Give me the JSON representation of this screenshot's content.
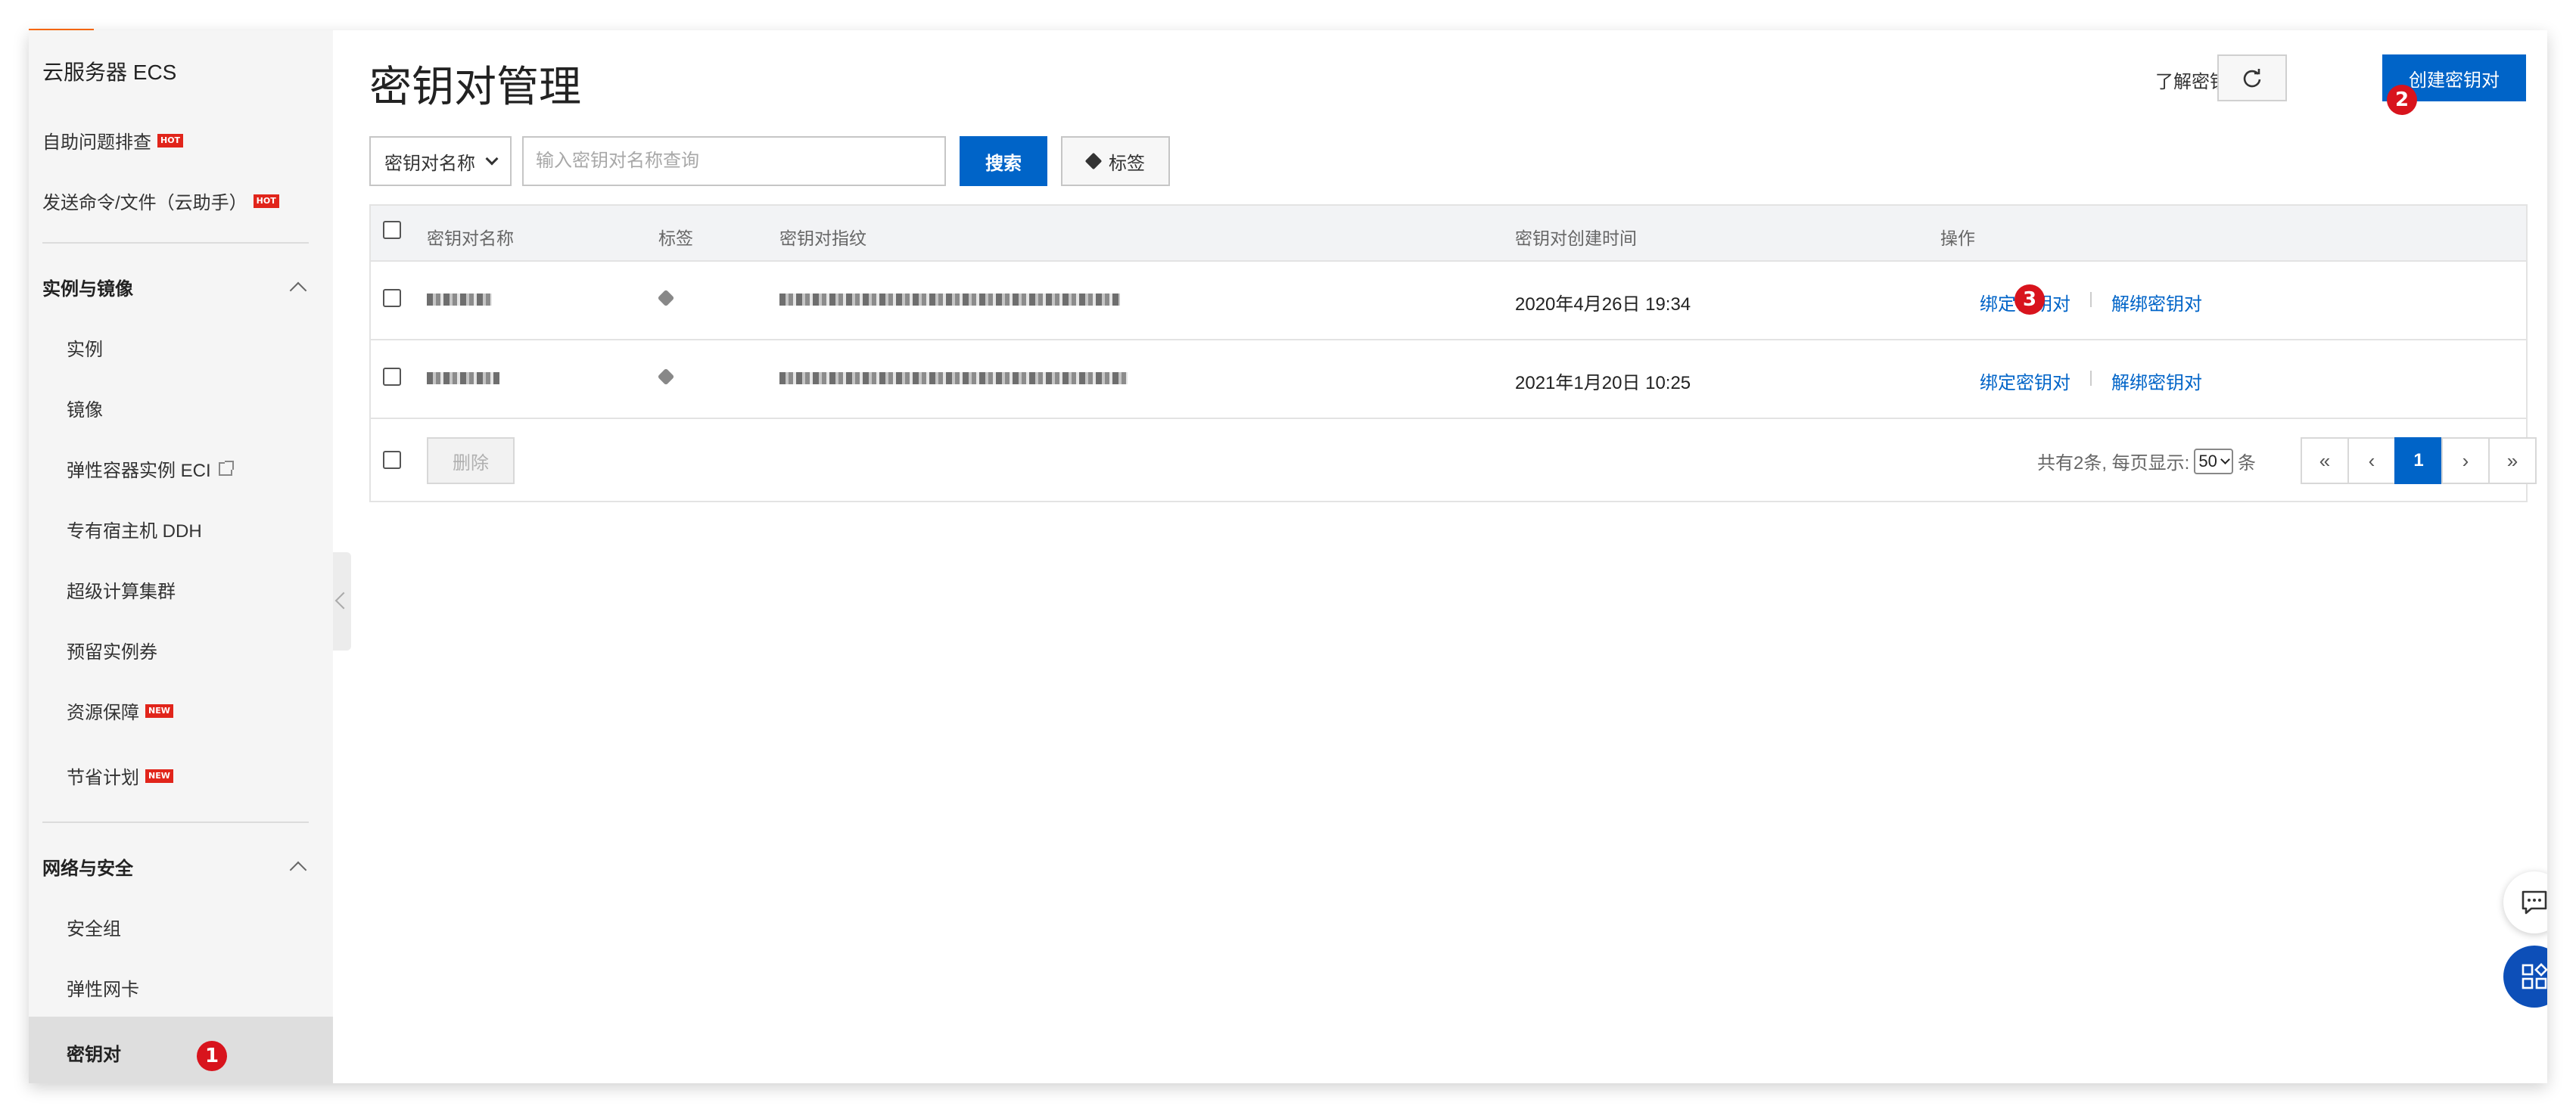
{
  "sidebar": {
    "title": "云服务器 ECS",
    "top_items": [
      {
        "label": "自助问题排查",
        "badge": "HOT"
      },
      {
        "label": "发送命令/文件（云助手）",
        "badge": "HOT"
      }
    ],
    "groups": [
      {
        "label": "实例与镜像",
        "items": [
          {
            "label": "实例"
          },
          {
            "label": "镜像"
          },
          {
            "label": "弹性容器实例 ECI"
          },
          {
            "label": "专有宿主机 DDH"
          },
          {
            "label": "超级计算集群"
          },
          {
            "label": "预留实例券"
          },
          {
            "label": "资源保障",
            "badge": "NEW"
          },
          {
            "label": "节省计划",
            "badge": "NEW"
          }
        ]
      },
      {
        "label": "网络与安全",
        "items": [
          {
            "label": "安全组"
          },
          {
            "label": "弹性网卡"
          },
          {
            "label": "密钥对"
          }
        ]
      }
    ]
  },
  "header": {
    "title": "密钥对管理",
    "help_link": "了解密钥对必读",
    "create_button": "创建密钥对"
  },
  "filter": {
    "select_value": "密钥对名称",
    "input_placeholder": "输入密钥对名称查询",
    "search_button": "搜索",
    "tag_button": "标签"
  },
  "table": {
    "columns": [
      "密钥对名称",
      "标签",
      "密钥对指纹",
      "密钥对创建时间",
      "操作"
    ],
    "rows": [
      {
        "created": "2020年4月26日 19:34",
        "bind": "绑定密钥对",
        "unbind": "解绑密钥对"
      },
      {
        "created": "2021年1月20日 10:25",
        "bind": "绑定密钥对",
        "unbind": "解绑密钥对"
      }
    ],
    "footer": {
      "delete_button": "删除",
      "total_prefix": "共有2条, 每页显示:",
      "page_size": "50",
      "total_suffix": "条"
    },
    "pagination": {
      "first": "«",
      "prev": "‹",
      "current": "1",
      "next": "›",
      "last": "»"
    }
  },
  "markers": [
    "1",
    "2",
    "3"
  ],
  "colors": {
    "primary": "#0064c8",
    "accent": "#ff6a00",
    "badge": "#e1251b",
    "marker": "#d8141d"
  },
  "icons": [
    "refresh-icon",
    "tags-icon",
    "tag-icon",
    "chat-icon",
    "apps-icon",
    "external-link-icon",
    "chevron-up-icon"
  ]
}
